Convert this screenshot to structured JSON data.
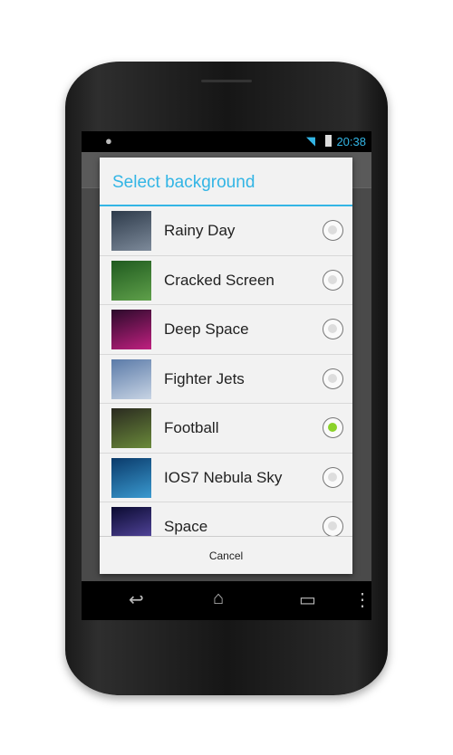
{
  "status": {
    "time": "20:38",
    "icons": [
      "android-icon",
      "rotate-icon",
      "wifi-icon",
      "signal-icon",
      "battery-charging-icon"
    ]
  },
  "dialog": {
    "title": "Select background",
    "cancel_label": "Cancel",
    "items": [
      {
        "label": "Rainy Day",
        "selected": false,
        "thumb": [
          "#2d3a4a",
          "#7d8a9a"
        ]
      },
      {
        "label": "Cracked Screen",
        "selected": false,
        "thumb": [
          "#1f5a1f",
          "#5fa04a"
        ]
      },
      {
        "label": "Deep Space",
        "selected": false,
        "thumb": [
          "#2a0a2a",
          "#c02080"
        ]
      },
      {
        "label": "Fighter Jets",
        "selected": false,
        "thumb": [
          "#5a7aa8",
          "#c8d4e4"
        ]
      },
      {
        "label": "Football",
        "selected": true,
        "thumb": [
          "#2a2a20",
          "#6a8a3a"
        ]
      },
      {
        "label": "IOS7 Nebula Sky",
        "selected": false,
        "thumb": [
          "#0a3a6a",
          "#3a9ad0"
        ]
      },
      {
        "label": "Space",
        "selected": false,
        "thumb": [
          "#0a0a30",
          "#6050b0"
        ]
      }
    ]
  },
  "accent": "#33b5e5",
  "selected_color": "#8bd22a"
}
